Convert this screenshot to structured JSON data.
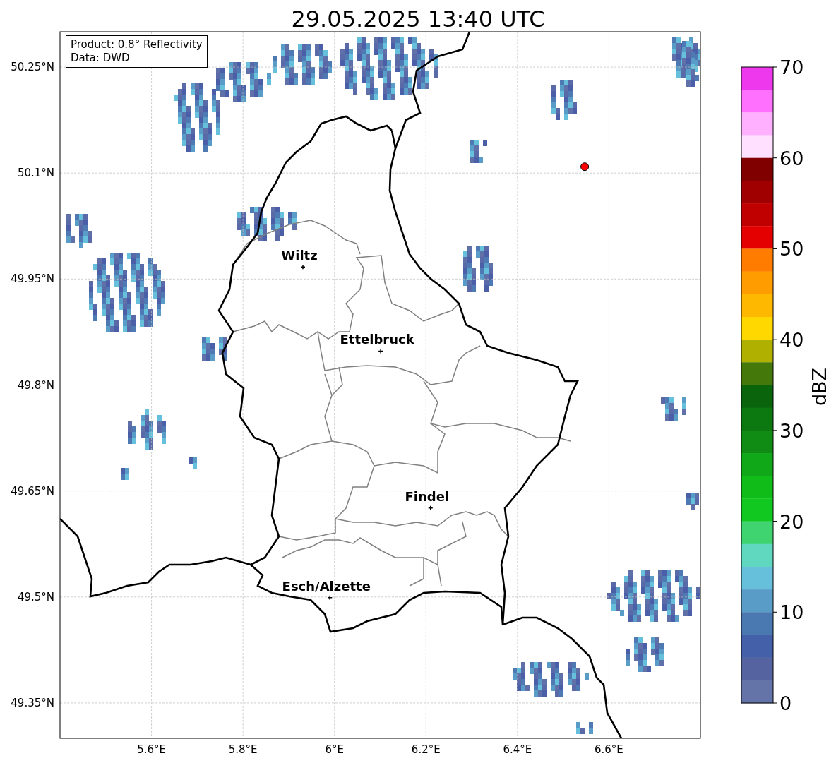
{
  "title": "29.05.2025 13:40 UTC",
  "info_box": [
    "Product: 0.8° Reflectivity",
    "Data: DWD"
  ],
  "map": {
    "lon_labels": [
      "5.6°E",
      "5.8°E",
      "6°E",
      "6.2°E",
      "6.4°E",
      "6.6°E"
    ],
    "lat_labels": [
      "50.25°N",
      "50.1°N",
      "49.95°N",
      "49.8°N",
      "49.65°N",
      "49.5°N",
      "49.35°N"
    ],
    "cities": [
      {
        "name": "Wiltz"
      },
      {
        "name": "Ettelbruck"
      },
      {
        "name": "Findel"
      },
      {
        "name": "Esch/Alzette"
      }
    ]
  },
  "colorbar": {
    "label": "dBZ",
    "ticks": [
      "70",
      "60",
      "50",
      "40",
      "30",
      "20",
      "10",
      "0"
    ],
    "segments": [
      {
        "color": "#ee38ee"
      },
      {
        "color": "#ff70ff"
      },
      {
        "color": "#ffb0ff"
      },
      {
        "color": "#ffe0ff"
      },
      {
        "color": "#800000"
      },
      {
        "color": "#a00000"
      },
      {
        "color": "#c00000"
      },
      {
        "color": "#e40000"
      },
      {
        "color": "#ff7c00"
      },
      {
        "color": "#ff9c00"
      },
      {
        "color": "#ffb800"
      },
      {
        "color": "#ffd800"
      },
      {
        "color": "#b0b000"
      },
      {
        "color": "#44780a"
      },
      {
        "color": "#0a640c"
      },
      {
        "color": "#0c7810"
      },
      {
        "color": "#108c14"
      },
      {
        "color": "#10a818"
      },
      {
        "color": "#10bc18"
      },
      {
        "color": "#10c820"
      },
      {
        "color": "#40d470"
      },
      {
        "color": "#60d8c0"
      },
      {
        "color": "#66c0dc"
      },
      {
        "color": "#5a9cc8"
      },
      {
        "color": "#4a78b0"
      },
      {
        "color": "#4460a8"
      },
      {
        "color": "#5564a0"
      },
      {
        "color": "#6474a8"
      }
    ]
  }
}
